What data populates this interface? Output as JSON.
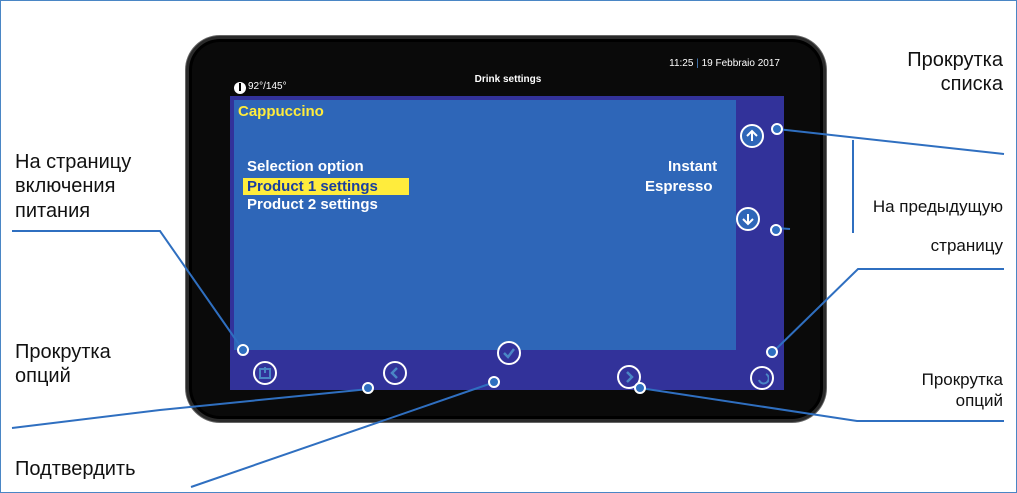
{
  "screen": {
    "temperature": "92°/145°",
    "title": "Drink settings",
    "time": "11:25",
    "separator": "|",
    "date": "19 Febbraio 2017",
    "drink_name": "Cappuccino",
    "menu": {
      "selection_option": "Selection option",
      "product1": "Product 1 settings",
      "product2": "Product 2 settings"
    },
    "value_line1": "Instant",
    "value_line2": "Espresso"
  },
  "callouts": {
    "scroll_list_1": "Прокрутка",
    "scroll_list_2": "списка",
    "power_page_1": "На страницу",
    "power_page_2": "включения",
    "power_page_3": "питания",
    "prev_page_1": "На предыдущую",
    "prev_page_2": "страницу",
    "scroll_options_left_1": "Прокрутка",
    "scroll_options_left_2": "опций",
    "scroll_options_right_1": "Прокрутка",
    "scroll_options_right_2": "опций",
    "confirm": "Подтвердить"
  },
  "colors": {
    "content_bg": "#2e66b8",
    "frame_bg": "#32329a",
    "highlight": "#ffec3c",
    "callout_line": "#2f6fc0"
  }
}
